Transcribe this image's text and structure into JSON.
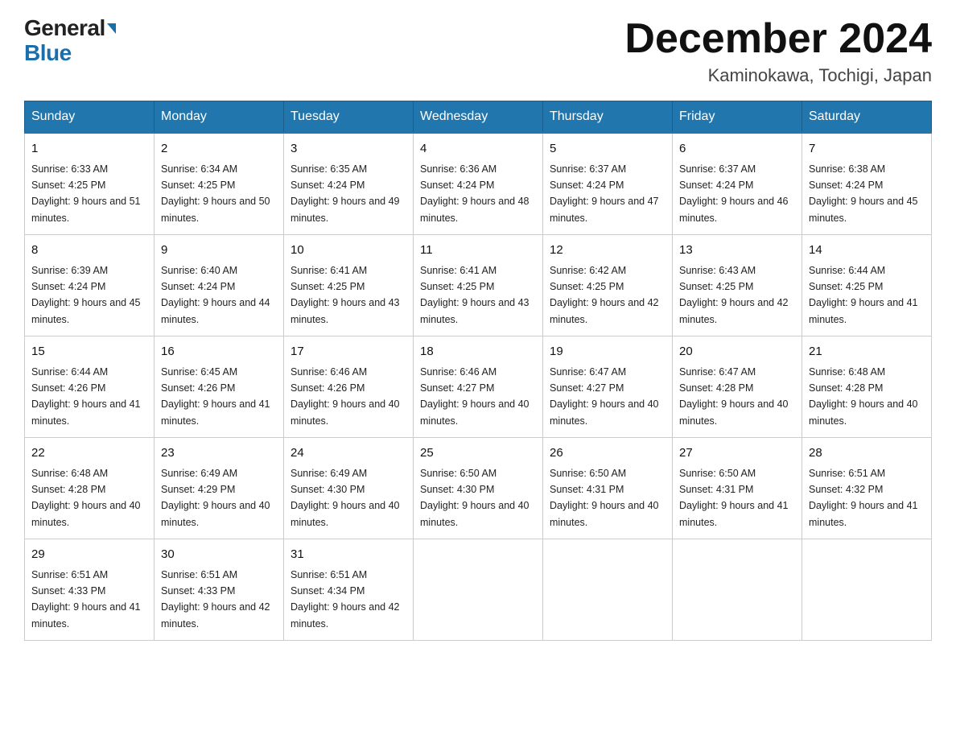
{
  "logo": {
    "general": "General",
    "blue": "Blue"
  },
  "title": "December 2024",
  "subtitle": "Kaminokawa, Tochigi, Japan",
  "days_of_week": [
    "Sunday",
    "Monday",
    "Tuesday",
    "Wednesday",
    "Thursday",
    "Friday",
    "Saturday"
  ],
  "weeks": [
    [
      {
        "day": "1",
        "sunrise": "6:33 AM",
        "sunset": "4:25 PM",
        "daylight": "9 hours and 51 minutes."
      },
      {
        "day": "2",
        "sunrise": "6:34 AM",
        "sunset": "4:25 PM",
        "daylight": "9 hours and 50 minutes."
      },
      {
        "day": "3",
        "sunrise": "6:35 AM",
        "sunset": "4:24 PM",
        "daylight": "9 hours and 49 minutes."
      },
      {
        "day": "4",
        "sunrise": "6:36 AM",
        "sunset": "4:24 PM",
        "daylight": "9 hours and 48 minutes."
      },
      {
        "day": "5",
        "sunrise": "6:37 AM",
        "sunset": "4:24 PM",
        "daylight": "9 hours and 47 minutes."
      },
      {
        "day": "6",
        "sunrise": "6:37 AM",
        "sunset": "4:24 PM",
        "daylight": "9 hours and 46 minutes."
      },
      {
        "day": "7",
        "sunrise": "6:38 AM",
        "sunset": "4:24 PM",
        "daylight": "9 hours and 45 minutes."
      }
    ],
    [
      {
        "day": "8",
        "sunrise": "6:39 AM",
        "sunset": "4:24 PM",
        "daylight": "9 hours and 45 minutes."
      },
      {
        "day": "9",
        "sunrise": "6:40 AM",
        "sunset": "4:24 PM",
        "daylight": "9 hours and 44 minutes."
      },
      {
        "day": "10",
        "sunrise": "6:41 AM",
        "sunset": "4:25 PM",
        "daylight": "9 hours and 43 minutes."
      },
      {
        "day": "11",
        "sunrise": "6:41 AM",
        "sunset": "4:25 PM",
        "daylight": "9 hours and 43 minutes."
      },
      {
        "day": "12",
        "sunrise": "6:42 AM",
        "sunset": "4:25 PM",
        "daylight": "9 hours and 42 minutes."
      },
      {
        "day": "13",
        "sunrise": "6:43 AM",
        "sunset": "4:25 PM",
        "daylight": "9 hours and 42 minutes."
      },
      {
        "day": "14",
        "sunrise": "6:44 AM",
        "sunset": "4:25 PM",
        "daylight": "9 hours and 41 minutes."
      }
    ],
    [
      {
        "day": "15",
        "sunrise": "6:44 AM",
        "sunset": "4:26 PM",
        "daylight": "9 hours and 41 minutes."
      },
      {
        "day": "16",
        "sunrise": "6:45 AM",
        "sunset": "4:26 PM",
        "daylight": "9 hours and 41 minutes."
      },
      {
        "day": "17",
        "sunrise": "6:46 AM",
        "sunset": "4:26 PM",
        "daylight": "9 hours and 40 minutes."
      },
      {
        "day": "18",
        "sunrise": "6:46 AM",
        "sunset": "4:27 PM",
        "daylight": "9 hours and 40 minutes."
      },
      {
        "day": "19",
        "sunrise": "6:47 AM",
        "sunset": "4:27 PM",
        "daylight": "9 hours and 40 minutes."
      },
      {
        "day": "20",
        "sunrise": "6:47 AM",
        "sunset": "4:28 PM",
        "daylight": "9 hours and 40 minutes."
      },
      {
        "day": "21",
        "sunrise": "6:48 AM",
        "sunset": "4:28 PM",
        "daylight": "9 hours and 40 minutes."
      }
    ],
    [
      {
        "day": "22",
        "sunrise": "6:48 AM",
        "sunset": "4:28 PM",
        "daylight": "9 hours and 40 minutes."
      },
      {
        "day": "23",
        "sunrise": "6:49 AM",
        "sunset": "4:29 PM",
        "daylight": "9 hours and 40 minutes."
      },
      {
        "day": "24",
        "sunrise": "6:49 AM",
        "sunset": "4:30 PM",
        "daylight": "9 hours and 40 minutes."
      },
      {
        "day": "25",
        "sunrise": "6:50 AM",
        "sunset": "4:30 PM",
        "daylight": "9 hours and 40 minutes."
      },
      {
        "day": "26",
        "sunrise": "6:50 AM",
        "sunset": "4:31 PM",
        "daylight": "9 hours and 40 minutes."
      },
      {
        "day": "27",
        "sunrise": "6:50 AM",
        "sunset": "4:31 PM",
        "daylight": "9 hours and 41 minutes."
      },
      {
        "day": "28",
        "sunrise": "6:51 AM",
        "sunset": "4:32 PM",
        "daylight": "9 hours and 41 minutes."
      }
    ],
    [
      {
        "day": "29",
        "sunrise": "6:51 AM",
        "sunset": "4:33 PM",
        "daylight": "9 hours and 41 minutes."
      },
      {
        "day": "30",
        "sunrise": "6:51 AM",
        "sunset": "4:33 PM",
        "daylight": "9 hours and 42 minutes."
      },
      {
        "day": "31",
        "sunrise": "6:51 AM",
        "sunset": "4:34 PM",
        "daylight": "9 hours and 42 minutes."
      },
      null,
      null,
      null,
      null
    ]
  ]
}
